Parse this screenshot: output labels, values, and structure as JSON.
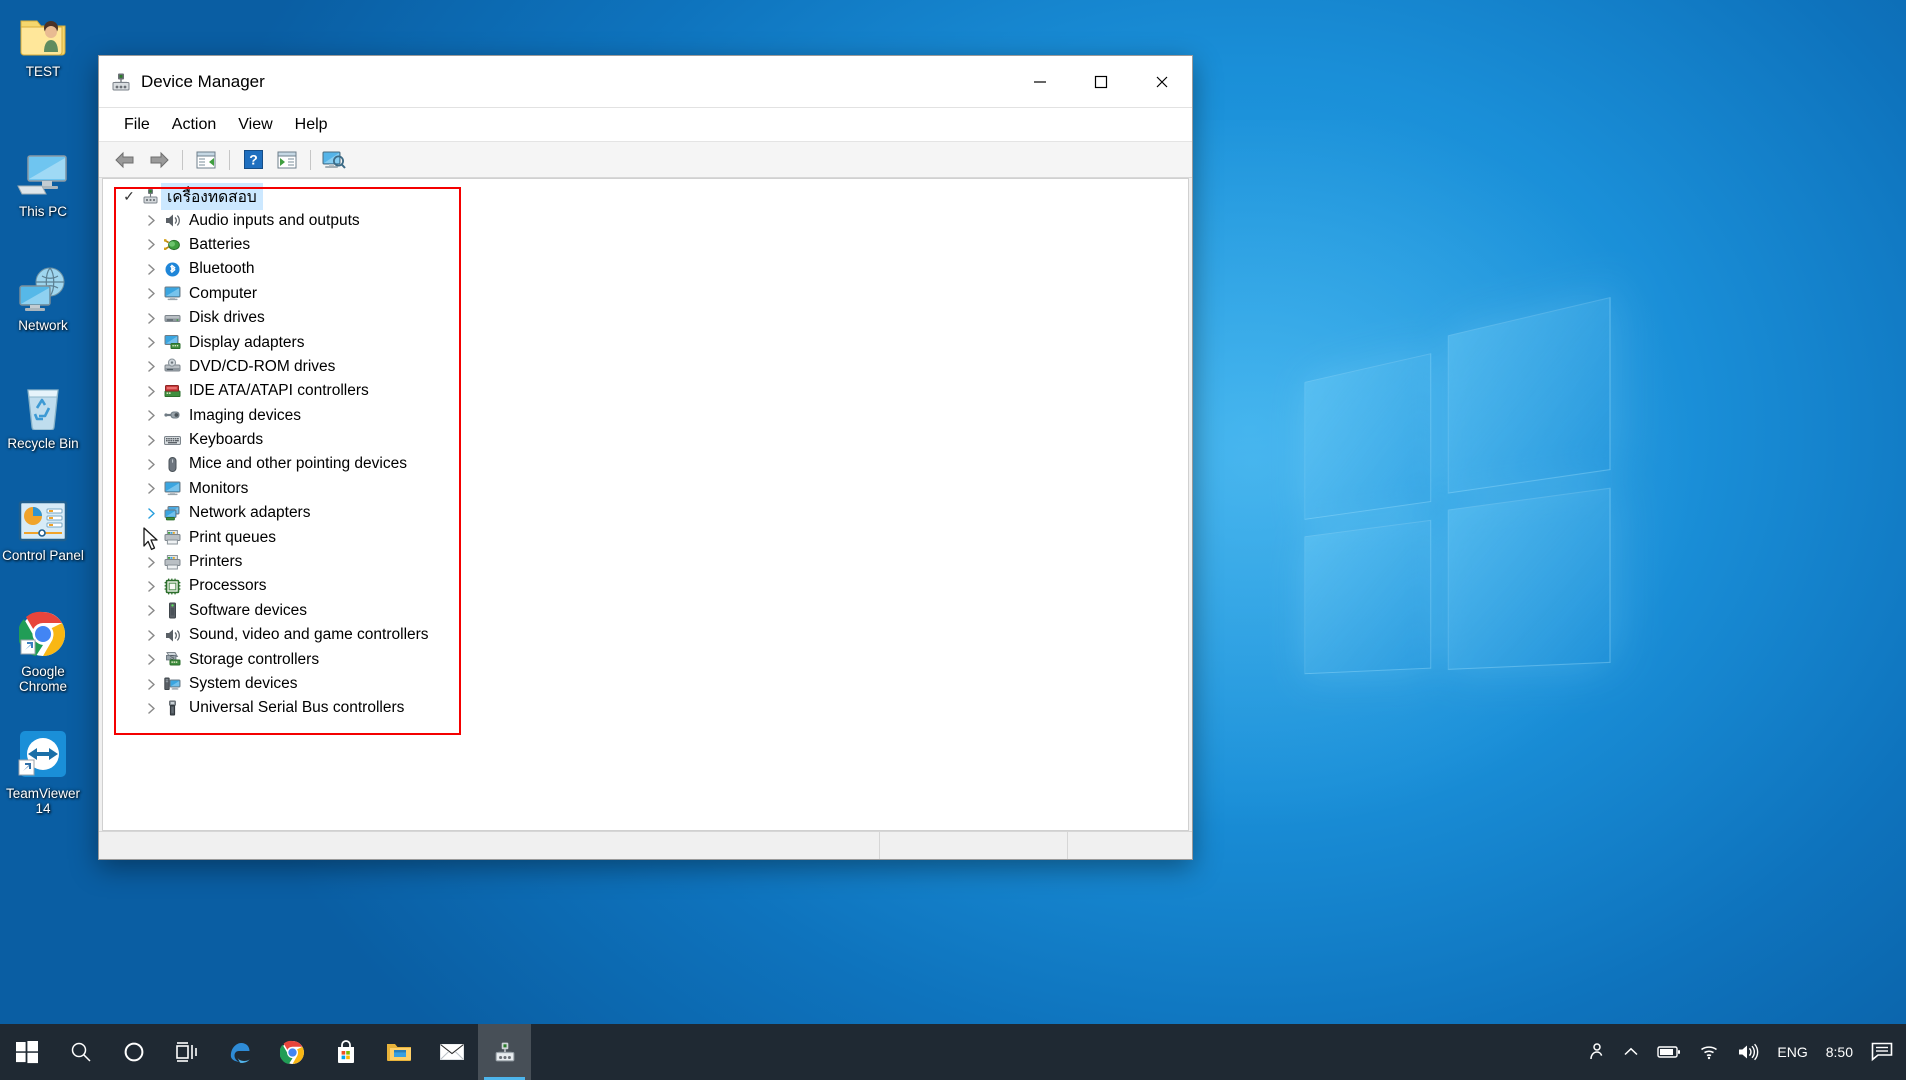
{
  "desktop": {
    "icons": [
      {
        "name": "test-folder",
        "label": "TEST",
        "icon": "user-folder-icon"
      },
      {
        "name": "this-pc",
        "label": "This PC",
        "icon": "computer-icon"
      },
      {
        "name": "network",
        "label": "Network",
        "icon": "network-globe-icon"
      },
      {
        "name": "recycle-bin",
        "label": "Recycle Bin",
        "icon": "recycle-bin-icon"
      },
      {
        "name": "control-panel",
        "label": "Control Panel",
        "icon": "control-panel-icon"
      },
      {
        "name": "google-chrome",
        "label": "Google Chrome",
        "icon": "chrome-icon"
      },
      {
        "name": "teamviewer",
        "label": "TeamViewer 14",
        "icon": "teamviewer-icon"
      }
    ]
  },
  "window": {
    "title": "Device Manager",
    "icon": "device-manager-icon",
    "controls": {
      "minimize": "Minimize",
      "maximize": "Maximize",
      "close": "Close"
    },
    "menu": [
      "File",
      "Action",
      "View",
      "Help"
    ],
    "toolbar": [
      {
        "name": "back-button",
        "title": "Back"
      },
      {
        "name": "forward-button",
        "title": "Forward"
      },
      {
        "name": "properties-button",
        "title": "Properties"
      },
      {
        "name": "help-button",
        "title": "Help"
      },
      {
        "name": "update-driver-button",
        "title": "Update driver"
      },
      {
        "name": "scan-hardware-button",
        "title": "Scan for hardware changes"
      }
    ]
  },
  "tree": {
    "root": {
      "label": "เครื่องทดสอบ",
      "icon": "computer-node-icon",
      "selected": true
    },
    "items": [
      {
        "label": "Audio inputs and outputs",
        "icon": "speaker-icon"
      },
      {
        "label": "Batteries",
        "icon": "battery-icon"
      },
      {
        "label": "Bluetooth",
        "icon": "bluetooth-icon"
      },
      {
        "label": "Computer",
        "icon": "monitor-icon"
      },
      {
        "label": "Disk drives",
        "icon": "disk-drive-icon"
      },
      {
        "label": "Display adapters",
        "icon": "display-adapter-icon"
      },
      {
        "label": "DVD/CD-ROM drives",
        "icon": "optical-drive-icon"
      },
      {
        "label": "IDE ATA/ATAPI controllers",
        "icon": "ide-controller-icon"
      },
      {
        "label": "Imaging devices",
        "icon": "imaging-device-icon"
      },
      {
        "label": "Keyboards",
        "icon": "keyboard-icon"
      },
      {
        "label": "Mice and other pointing devices",
        "icon": "mouse-icon"
      },
      {
        "label": "Monitors",
        "icon": "monitor-icon"
      },
      {
        "label": "Network adapters",
        "icon": "network-adapter-icon",
        "hover": true
      },
      {
        "label": "Print queues",
        "icon": "printer-icon"
      },
      {
        "label": "Printers",
        "icon": "printer-icon"
      },
      {
        "label": "Processors",
        "icon": "processor-icon"
      },
      {
        "label": "Software devices",
        "icon": "software-device-icon"
      },
      {
        "label": "Sound, video and game controllers",
        "icon": "speaker-icon"
      },
      {
        "label": "Storage controllers",
        "icon": "storage-controller-icon"
      },
      {
        "label": "System devices",
        "icon": "system-device-icon"
      },
      {
        "label": "Universal Serial Bus controllers",
        "icon": "usb-icon"
      }
    ]
  },
  "annotation": {
    "name": "red-highlight-box",
    "color": "#f40000"
  },
  "taskbar": {
    "buttons": [
      {
        "name": "start-button",
        "icon": "windows-logo-icon"
      },
      {
        "name": "search-button",
        "icon": "search-icon"
      },
      {
        "name": "cortana-button",
        "icon": "cortana-circle-icon"
      },
      {
        "name": "task-view-button",
        "icon": "task-view-icon"
      },
      {
        "name": "edge-button",
        "icon": "edge-icon"
      },
      {
        "name": "chrome-button",
        "icon": "chrome-icon"
      },
      {
        "name": "store-button",
        "icon": "microsoft-store-icon"
      },
      {
        "name": "file-explorer-button",
        "icon": "file-explorer-icon"
      },
      {
        "name": "mail-button",
        "icon": "mail-icon"
      },
      {
        "name": "device-manager-button",
        "icon": "device-manager-icon",
        "active": true
      }
    ],
    "tray": {
      "people": "people-icon",
      "chevron": "chevron-up-icon",
      "battery": "battery-icon",
      "network": "wifi-icon",
      "volume": "volume-icon",
      "language": "ENG",
      "time": "8:50",
      "action_center": "action-center-icon"
    }
  }
}
